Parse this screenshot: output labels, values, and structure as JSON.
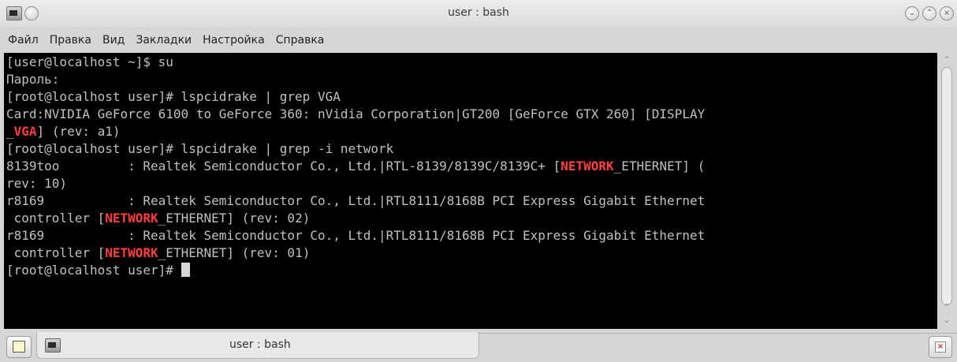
{
  "window": {
    "title": "user : bash"
  },
  "menu": [
    "Файл",
    "Правка",
    "Вид",
    "Закладки",
    "Настройка",
    "Справка"
  ],
  "terminal": {
    "lines": [
      [
        {
          "t": "[user@localhost ~]$ su"
        }
      ],
      [
        {
          "t": "Пароль:"
        }
      ],
      [
        {
          "t": "[root@localhost user]# lspcidrake | grep VGA"
        }
      ],
      [
        {
          "t": "Card:NVIDIA GeForce 6100 to GeForce 360: nVidia Corporation|GT200 [GeForce GTX 260] [DISPLAY"
        }
      ],
      [
        {
          "t": "_"
        },
        {
          "t": "VGA",
          "hl": true
        },
        {
          "t": "] (rev: a1)"
        }
      ],
      [
        {
          "t": "[root@localhost user]# lspcidrake | grep -i network"
        }
      ],
      [
        {
          "t": "8139too         : Realtek Semiconductor Co., Ltd.|RTL-8139/8139C/8139C+ ["
        },
        {
          "t": "NETWORK",
          "hl": true
        },
        {
          "t": "_ETHERNET] ("
        }
      ],
      [
        {
          "t": "rev: 10)"
        }
      ],
      [
        {
          "t": "r8169           : Realtek Semiconductor Co., Ltd.|RTL8111/8168B PCI Express Gigabit Ethernet"
        }
      ],
      [
        {
          "t": " controller ["
        },
        {
          "t": "NETWORK",
          "hl": true
        },
        {
          "t": "_ETHERNET] (rev: 02)"
        }
      ],
      [
        {
          "t": "r8169           : Realtek Semiconductor Co., Ltd.|RTL8111/8168B PCI Express Gigabit Ethernet"
        }
      ],
      [
        {
          "t": " controller ["
        },
        {
          "t": "NETWORK",
          "hl": true
        },
        {
          "t": "_ETHERNET] (rev: 01)"
        }
      ],
      [
        {
          "t": "[root@localhost user]# "
        },
        {
          "cursor": true
        }
      ]
    ],
    "highlight_color": "#ff4040",
    "text_color": "#c0c0c0",
    "background": "#000000"
  },
  "tabs": [
    {
      "label": "user : bash",
      "icon": "terminal-icon"
    }
  ],
  "icons": {
    "window": "terminal-icon",
    "sticky": "sticky-icon",
    "minimize": "chevron-down-icon",
    "maximize": "chevron-up-icon",
    "close": "close-icon",
    "new_tab": "new-tab-icon",
    "close_tab": "close-tab-icon"
  }
}
